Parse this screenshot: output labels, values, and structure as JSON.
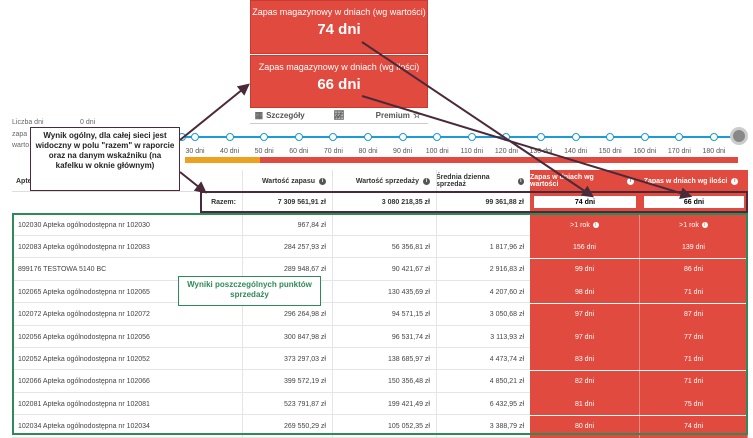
{
  "kpis": [
    {
      "label": "Zapas magazynowy w dniach (wg wartości)",
      "value": "74 dni"
    },
    {
      "label": "Zapas magazynowy w dniach (wg ilości)",
      "value": "66 dni"
    }
  ],
  "tabs": [
    {
      "label": "Szczegóły",
      "icon": "table-icon"
    },
    {
      "label": "",
      "icon": "chart-line-icon"
    },
    {
      "label": "Premium",
      "icon": "star-icon"
    }
  ],
  "slider": {
    "label_days": "Liczba dni",
    "label_zapa": "zapa",
    "label_warto": "warto",
    "zero": "0 dni",
    "ticks": [
      "30 dni",
      "40 dni",
      "50 dni",
      "60 dni",
      "70 dni",
      "80 dni",
      "90 dni",
      "100 dni",
      "110 dni",
      "120 dni",
      "130 dni",
      "140 dni",
      "150 dni",
      "160 dni",
      "170 dni",
      "180 dni"
    ]
  },
  "table": {
    "headers": [
      "Apte",
      "Wartość zapasu",
      "Wartość sprzedaży",
      "Średnia dzienna sprzedaż",
      "Zapas w dniach wg wartości",
      "Zapas w dniach wg ilości"
    ],
    "total": {
      "label": "Razem:",
      "stock_value": "7 309 561,91 zł",
      "sales_value": "3 080 218,35 zł",
      "avg_daily": "99 361,88 zł",
      "days_value": "74 dni",
      "days_qty": "66 dni"
    },
    "rows": [
      {
        "name": "102030 Apteka ogólnodostępna nr 102030",
        "stock": "967,84 zł",
        "sales": "",
        "avg": "",
        "days_v": ">1 rok",
        "days_q": ">1 rok",
        "info": true
      },
      {
        "name": "102083 Apteka ogólnodostępna nr 102083",
        "stock": "284 257,93 zł",
        "sales": "56 356,81 zł",
        "avg": "1 817,96 zł",
        "days_v": "156 dni",
        "days_q": "139 dni",
        "info": false
      },
      {
        "name": "899176 TESTOWA 5140 BC",
        "stock": "289 948,67 zł",
        "sales": "90 421,67 zł",
        "avg": "2 916,83 zł",
        "days_v": "99 dni",
        "days_q": "86 dni",
        "info": false
      },
      {
        "name": "102065 Apteka ogólnodostępna nr 102065",
        "stock": "",
        "sales": "130 435,69 zł",
        "avg": "4 207,60 zł",
        "days_v": "98 dni",
        "days_q": "71 dni",
        "info": false
      },
      {
        "name": "102072 Apteka ogólnodostępna nr 102072",
        "stock": "296 264,98 zł",
        "sales": "94 571,15 zł",
        "avg": "3 050,68 zł",
        "days_v": "97 dni",
        "days_q": "87 dni",
        "info": false
      },
      {
        "name": "102056 Apteka ogólnodostępna nr 102056",
        "stock": "300 847,98 zł",
        "sales": "96 531,74 zł",
        "avg": "3 113,93 zł",
        "days_v": "97 dni",
        "days_q": "77 dni",
        "info": false
      },
      {
        "name": "102052 Apteka ogólnodostępna nr 102052",
        "stock": "373 297,03 zł",
        "sales": "138 685,97 zł",
        "avg": "4 473,74 zł",
        "days_v": "83 dni",
        "days_q": "71 dni",
        "info": false
      },
      {
        "name": "102066 Apteka ogólnodostępna nr 102066",
        "stock": "399 572,19 zł",
        "sales": "150 356,48 zł",
        "avg": "4 850,21 zł",
        "days_v": "82 dni",
        "days_q": "71 dni",
        "info": false
      },
      {
        "name": "102081 Apteka ogólnodostępna nr 102081",
        "stock": "523 791,87 zł",
        "sales": "199 421,49 zł",
        "avg": "6 432,95 zł",
        "days_v": "81 dni",
        "days_q": "75 dni",
        "info": false
      },
      {
        "name": "102034 Apteka ogólnodostępna nr 102034",
        "stock": "269 550,29 zł",
        "sales": "105 052,35 zł",
        "avg": "3 388,79 zł",
        "days_v": "80 dni",
        "days_q": "74 dni",
        "info": false
      }
    ]
  },
  "annotations": {
    "note_total": "Wynik ogólny, dla całej sieci jest widoczny w polu \"razem\" w raporcie oraz na danym wskaźniku (na kafelku w oknie głównym)",
    "note_rows": "Wyniki poszczególnych punktów sprzedaży"
  },
  "colors": {
    "accent_red": "#e04a3f",
    "slider_blue": "#1e9ad6",
    "frame_green": "#2e8b57",
    "frame_dark": "#4a2a3a",
    "bar_orange": "#f0a020"
  }
}
